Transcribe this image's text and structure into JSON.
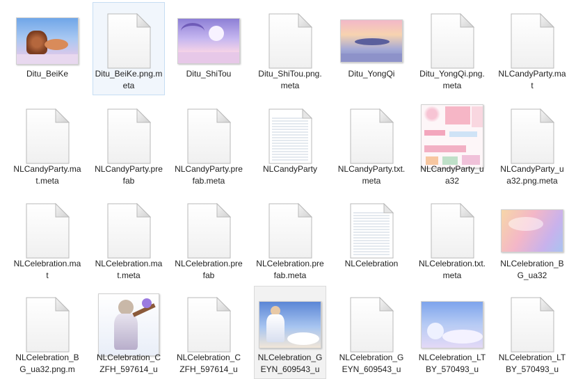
{
  "window": {
    "view": "large-icons"
  },
  "colors": {
    "selected_bg": "#f1f6fc",
    "selected_border": "#c6ddf3",
    "hover_bg": "#f2f2f2"
  },
  "files": [
    {
      "name": "Ditu_BeiKe",
      "icon": "image-thumbnail-beike"
    },
    {
      "name": "Ditu_BeiKe.png.meta",
      "icon": "blank-file-icon",
      "selected": true
    },
    {
      "name": "Ditu_ShiTou",
      "icon": "image-thumbnail-shitou"
    },
    {
      "name": "Ditu_ShiTou.png.meta",
      "icon": "blank-file-icon"
    },
    {
      "name": "Ditu_YongQi",
      "icon": "image-thumbnail-yongqi"
    },
    {
      "name": "Ditu_YongQi.png.meta",
      "icon": "blank-file-icon"
    },
    {
      "name": "NLCandyParty.mat",
      "icon": "blank-file-icon"
    },
    {
      "name": "NLCandyParty.mat.meta",
      "icon": "blank-file-icon"
    },
    {
      "name": "NLCandyParty.prefab",
      "icon": "blank-file-icon"
    },
    {
      "name": "NLCandyParty.prefab.meta",
      "icon": "blank-file-icon"
    },
    {
      "name": "NLCandyParty",
      "icon": "text-file-icon"
    },
    {
      "name": "NLCandyParty.txt.meta",
      "icon": "blank-file-icon"
    },
    {
      "name": "NLCandyParty_ua32",
      "icon": "image-thumbnail-candy-atlas"
    },
    {
      "name": "NLCandyParty_ua32.png.meta",
      "icon": "blank-file-icon"
    },
    {
      "name": "NLCelebration.mat",
      "icon": "blank-file-icon"
    },
    {
      "name": "NLCelebration.mat.meta",
      "icon": "blank-file-icon"
    },
    {
      "name": "NLCelebration.prefab",
      "icon": "blank-file-icon"
    },
    {
      "name": "NLCelebration.prefab.meta",
      "icon": "blank-file-icon"
    },
    {
      "name": "NLCelebration",
      "icon": "text-file-icon"
    },
    {
      "name": "NLCelebration.txt.meta",
      "icon": "blank-file-icon"
    },
    {
      "name": "NLCelebration_BG_ua32",
      "icon": "image-thumbnail-celebration-bg"
    },
    {
      "name": "NLCelebration_BG_ua32.png.m",
      "icon": "blank-file-icon"
    },
    {
      "name": "NLCelebration_CZFH_597614_u",
      "icon": "image-thumbnail-czfh"
    },
    {
      "name": "NLCelebration_CZFH_597614_u",
      "icon": "blank-file-icon"
    },
    {
      "name": "NLCelebration_GEYN_609543_u",
      "icon": "image-thumbnail-geyn",
      "hover": true
    },
    {
      "name": "NLCelebration_GEYN_609543_u",
      "icon": "blank-file-icon"
    },
    {
      "name": "NLCelebration_LTBY_570493_u",
      "icon": "image-thumbnail-ltby"
    },
    {
      "name": "NLCelebration_LTBY_570493_u",
      "icon": "blank-file-icon"
    }
  ]
}
